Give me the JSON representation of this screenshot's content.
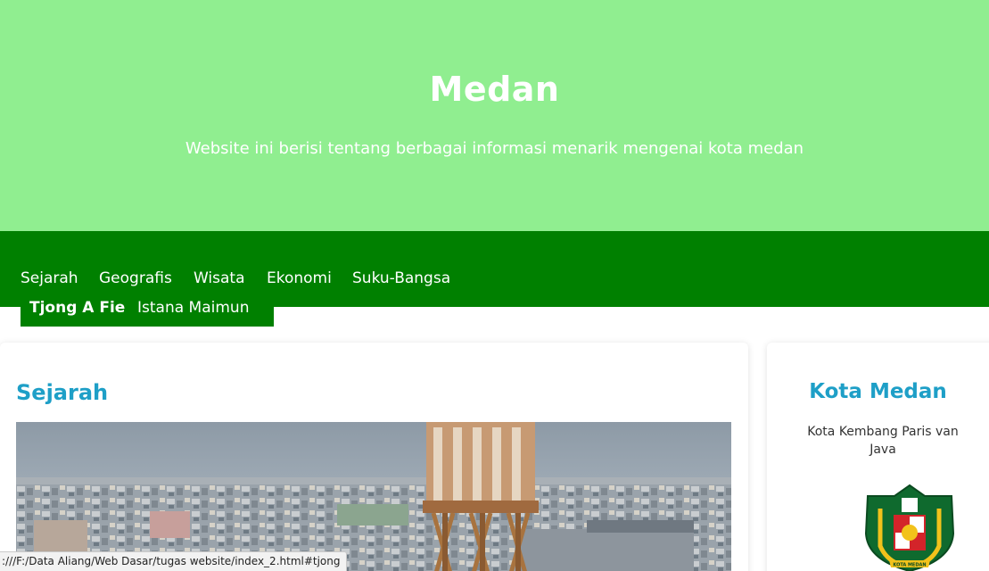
{
  "header": {
    "title": "Medan",
    "subtitle": "Website ini berisi tentang berbagai informasi menarik mengenai kota medan"
  },
  "nav": {
    "items": [
      "Sejarah",
      "Geografis",
      "Wisata",
      "Ekonomi",
      "Suku-Bangsa"
    ],
    "dropdown": {
      "items": [
        "Tjong A Fie",
        "Istana Maimun"
      ],
      "active": "Tjong A Fie"
    }
  },
  "main": {
    "heading": "Sejarah",
    "image": "medan-city-tower-photo"
  },
  "sidebar": {
    "heading": "Kota Medan",
    "text": "Kota Kembang Paris van Java",
    "image": "kota-medan-emblem",
    "emblem_text": "KOTA MEDAN"
  },
  "statusbar": {
    "url": ":///F:/Data Aliang/Web Dasar/tugas website/index_2.html#tjong"
  },
  "colors": {
    "header_bg": "#90ee90",
    "nav_bg": "#008000",
    "heading": "#1e9fc7"
  }
}
